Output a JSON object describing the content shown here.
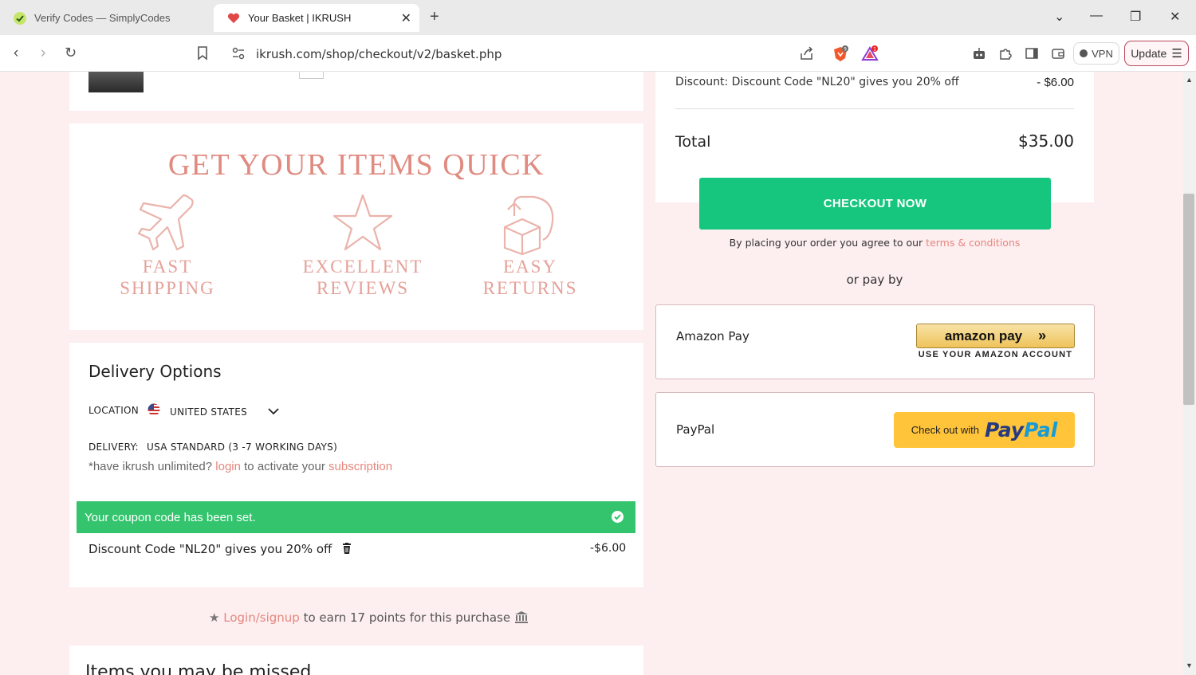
{
  "browser": {
    "tabs": [
      {
        "title": "Verify Codes — SimplyCodes",
        "active": false
      },
      {
        "title": "Your Basket | IKRUSH",
        "active": true
      }
    ],
    "url": "ikrush.com/shop/checkout/v2/basket.php",
    "vpn_label": "VPN",
    "update_label": "Update",
    "brave_badge": "9",
    "rewards_badge": "1"
  },
  "features": {
    "title": "GET YOUR ITEMS QUICK",
    "items": [
      {
        "line1": "FAST",
        "line2": "SHIPPING",
        "icon": "airplane-icon"
      },
      {
        "line1": "EXCELLENT",
        "line2": "REVIEWS",
        "icon": "star-icon"
      },
      {
        "line1": "EASY",
        "line2": "RETURNS",
        "icon": "return-box-icon"
      }
    ]
  },
  "delivery": {
    "title": "Delivery Options",
    "location_label": "LOCATION",
    "location_value": "UNITED STATES",
    "delivery_label": "DELIVERY:",
    "delivery_value": "USA STANDARD (3 -7 WORKING DAYS)",
    "note_prefix": "*have ikrush unlimited?",
    "note_login": "login",
    "note_middle": "to activate your",
    "note_subscription": "subscription"
  },
  "coupon": {
    "message": "Your coupon code has been set.",
    "discount_text": "Discount Code \"NL20\" gives you 20% off",
    "discount_amount": "-$6.00"
  },
  "points": {
    "link": "Login/signup",
    "text": "to earn 17 points for this purchase"
  },
  "summary": {
    "discount_text": "Discount: Discount Code \"NL20\" gives you 20% off",
    "discount_amount": "- $6.00",
    "total_label": "Total",
    "total_amount": "$35.00",
    "checkout_label": "CHECKOUT NOW",
    "terms_prefix": "By placing your order you agree to our",
    "terms_link": "terms & conditions",
    "or_pay": "or pay by"
  },
  "payment_options": {
    "amazon": {
      "label": "Amazon Pay",
      "button_text": "amazon pay",
      "sub_text": "USE YOUR AMAZON ACCOUNT"
    },
    "paypal": {
      "label": "PayPal",
      "button_prefix": "Check out with",
      "logo_part1": "Pay",
      "logo_part2": "Pal"
    }
  },
  "items_title": "Items you may be missed"
}
